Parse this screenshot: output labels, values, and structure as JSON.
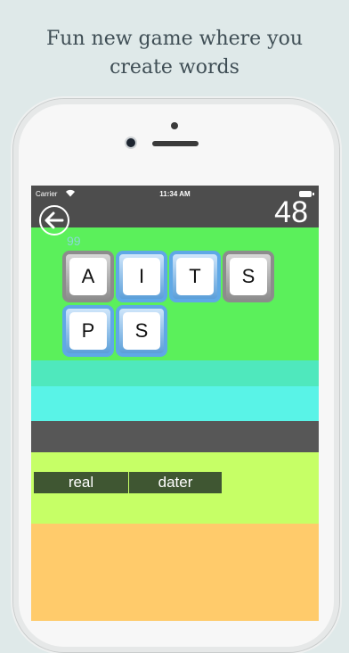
{
  "headline": {
    "line1": "Fun new game where you",
    "line2": "create words"
  },
  "status_bar": {
    "carrier": "Carrier",
    "time": "11:34 AM",
    "icons": [
      "wifi-icon",
      "battery-icon"
    ]
  },
  "game": {
    "score": "48",
    "tiny_count": "99",
    "back_icon": "back-arrow-icon",
    "tiles_row1": [
      "A",
      "I",
      "T",
      "S"
    ],
    "tiles_row2": [
      "P",
      "S"
    ],
    "found_words": [
      "real",
      "dater"
    ]
  },
  "colors": {
    "play_area": "#5bf05b",
    "tile_gray": "#8c8c8c",
    "tile_blue": "#5fa8e6",
    "words_area": "#c6ff66",
    "word_chip": "#3f5632",
    "bottom_area": "#ffcb6b"
  }
}
